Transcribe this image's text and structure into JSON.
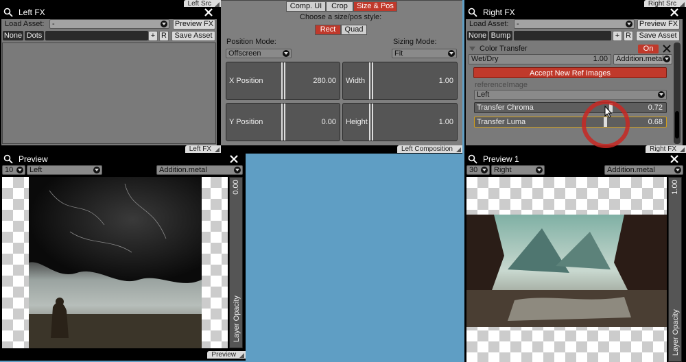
{
  "left_fx": {
    "tab_top": "Left Src",
    "title": "Left FX",
    "load_asset_label": "Load Asset:",
    "load_asset_value": "-",
    "preview_fx_button": "Preview FX",
    "none_button": "None",
    "dots_button": "Dots",
    "plus_button": "+",
    "r_button": "R",
    "save_asset_button": "Save Asset",
    "tab_bottom": "Left FX"
  },
  "composition": {
    "tabs": [
      {
        "label": "Comp. UI",
        "active": false
      },
      {
        "label": "Crop",
        "active": false
      },
      {
        "label": "Size & Pos",
        "active": true
      }
    ],
    "choose_label": "Choose a size/pos style:",
    "style_rect": "Rect",
    "style_quad": "Quad",
    "position_mode_label": "Position Mode:",
    "position_mode_value": "Offscreen",
    "sizing_mode_label": "Sizing Mode:",
    "sizing_mode_value": "Fit",
    "x_label": "X Position",
    "x_value": "280.00",
    "width_label": "Width",
    "width_value": "1.00",
    "y_label": "Y Position",
    "y_value": "0.00",
    "height_label": "Height",
    "height_value": "1.00",
    "tab_bottom": "Left Composition"
  },
  "right_fx": {
    "tab_top": "Right Src",
    "title": "Right FX",
    "load_asset_label": "Load Asset:",
    "load_asset_value": "-",
    "preview_fx_button": "Preview FX",
    "none_button": "None",
    "bump_button": "Bump",
    "plus_button": "+",
    "r_button": "R",
    "save_asset_button": "Save Asset",
    "effect_name": "Color Transfer",
    "on_button": "On",
    "wet_dry_label": "Wet/Dry",
    "wet_dry_value": "1.00",
    "blend_value": "Addition.metal",
    "accept_button": "Accept New Ref Images",
    "ref_image_label": "referenceImage",
    "ref_image_value": "Left",
    "chroma_label": "Transfer Chroma",
    "chroma_value": "0.72",
    "luma_label": "Transfer Luma",
    "luma_value": "0.68",
    "tab_bottom": "Right FX"
  },
  "preview": {
    "title": "Preview",
    "number_value": "10",
    "source_value": "Left",
    "blend_value": "Addition.metal",
    "opacity_value": "0.00",
    "opacity_label": "Layer Opacity",
    "tab_bottom": "Preview"
  },
  "preview1": {
    "title": "Preview 1",
    "number_value": "30",
    "source_value": "Right",
    "blend_value": "Addition.metal",
    "opacity_value": "1.00",
    "opacity_label": "Layer Opacity"
  },
  "colors": {
    "accent_red": "#c0392b",
    "panel_gray": "#7a7a7a",
    "desktop_blue": "#5f9ec4"
  }
}
